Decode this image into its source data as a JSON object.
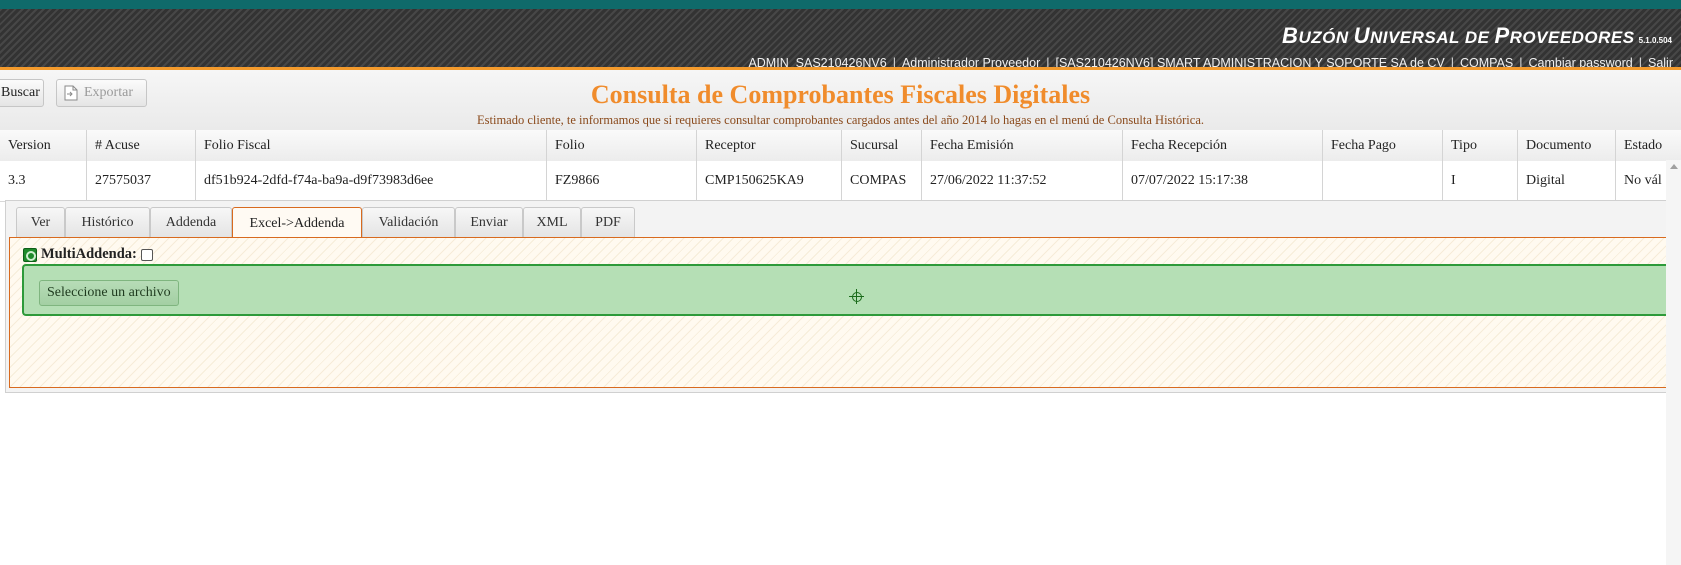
{
  "header": {
    "brand": {
      "part1_initial": "B",
      "part1_rest": "UZÓN",
      "part2_initial": "U",
      "part2_rest": "NIVERSAL",
      "part3": "DE",
      "part4_initial": "P",
      "part4_rest": "ROVEEDORES",
      "version": "5.1.0.504"
    },
    "user": {
      "username": "ADMIN_SAS210426NV6",
      "role": "Administrador Proveedor",
      "company": "[SAS210426NV6] SMART ADMINISTRACION Y SOPORTE SA de CV",
      "group": "COMPAS",
      "change_password": "Cambiar password",
      "logout": "Salir",
      "separator": "|"
    }
  },
  "toolbar": {
    "search_label": "Buscar",
    "export_label": "Exportar"
  },
  "page": {
    "title": "Consulta de Comprobantes Fiscales Digitales",
    "notice": "Estimado cliente, te informamos que si requieres consultar comprobantes cargados antes del año 2014 lo hagas en el menú de Consulta Histórica."
  },
  "grid": {
    "columns": [
      "Version",
      "# Acuse",
      "Folio Fiscal",
      "Folio",
      "Receptor",
      "Sucursal",
      "Fecha Emisión",
      "Fecha Recepción",
      "Fecha Pago",
      "Tipo",
      "Documento",
      "Estado"
    ],
    "rows": [
      [
        "3.3",
        "27575037",
        "df51b924-2dfd-f74a-ba9a-d9f73983d6ee",
        "FZ9866",
        "CMP150625KA9",
        "COMPAS",
        "27/06/2022 11:37:52",
        "07/07/2022 15:17:38",
        "",
        "I",
        "Digital",
        "No vál"
      ]
    ]
  },
  "detail": {
    "tabs": [
      "Ver",
      "Histórico",
      "Addenda",
      "Excel->Addenda",
      "Validación",
      "Enviar",
      "XML",
      "PDF"
    ],
    "active_tab": "Excel->Addenda",
    "multiaddenda_label": "MultiAddenda:",
    "multiaddenda_checked": false,
    "file_button_label": "Seleccione un archivo"
  },
  "colors": {
    "accent": "#f08c2c",
    "topbar": "#0f6a6a",
    "dropzone": "#b5dfb5",
    "active_tab_border": "#d86a1e"
  },
  "icons": {
    "export": "export-file-icon",
    "multiaddenda": "target-badge-icon",
    "drop_target": "crosshair-icon",
    "scroll": "scroll-up-arrow-icon"
  }
}
